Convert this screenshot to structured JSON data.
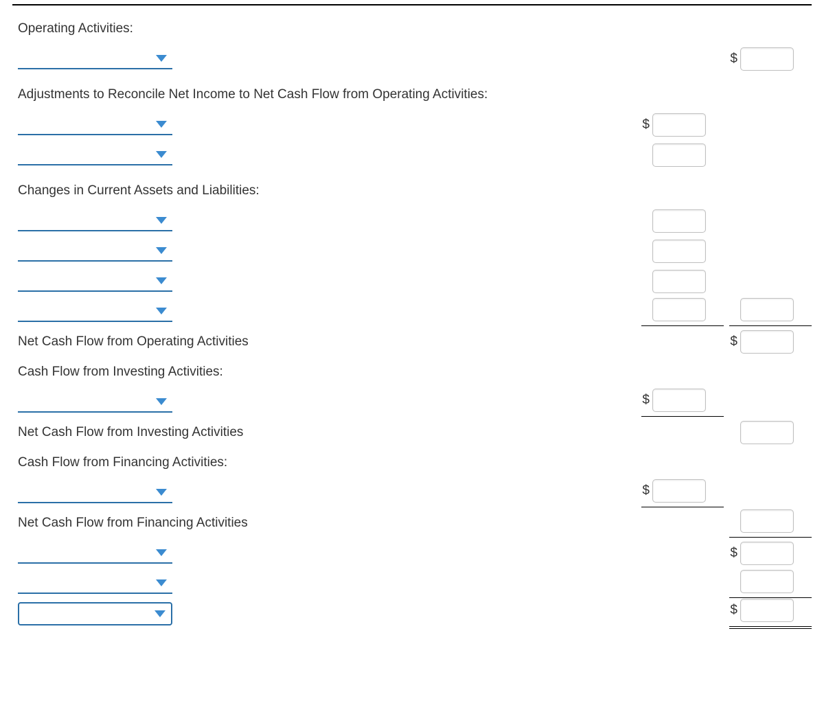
{
  "headings": {
    "operating": "Operating Activities:",
    "adjustments": "Adjustments to Reconcile Net Income to Net Cash Flow from Operating Activities:",
    "changes": "Changes in Current Assets and Liabilities:",
    "net_operating": "Net Cash Flow from Operating Activities",
    "investing": "Cash Flow from Investing Activities:",
    "net_investing": "Net Cash Flow from Investing Activities",
    "financing": "Cash Flow from Financing Activities:",
    "net_financing": "Net Cash Flow from Financing Activities"
  },
  "currency_symbol": "$"
}
